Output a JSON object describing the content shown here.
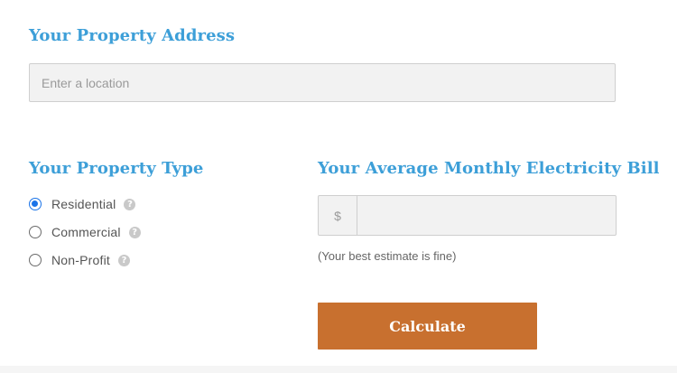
{
  "address": {
    "heading": "Your Property Address",
    "placeholder": "Enter a location",
    "value": ""
  },
  "property_type": {
    "heading": "Your Property Type",
    "options": [
      {
        "label": "Residential",
        "checked": true,
        "help_icon": "question-circle-icon"
      },
      {
        "label": "Commercial",
        "checked": false,
        "help_icon": "question-circle-icon"
      },
      {
        "label": "Non-Profit",
        "checked": false,
        "help_icon": "question-circle-icon"
      }
    ]
  },
  "bill": {
    "heading": "Your Average Monthly Electricity Bill",
    "currency_symbol": "$",
    "value": "",
    "hint": "(Your best estimate is fine)"
  },
  "actions": {
    "calculate_label": "Calculate"
  },
  "colors": {
    "heading": "#3d9fd8",
    "button": "#c8702f",
    "radio_checked": "#1a73e8",
    "input_bg": "#f2f2f2"
  }
}
